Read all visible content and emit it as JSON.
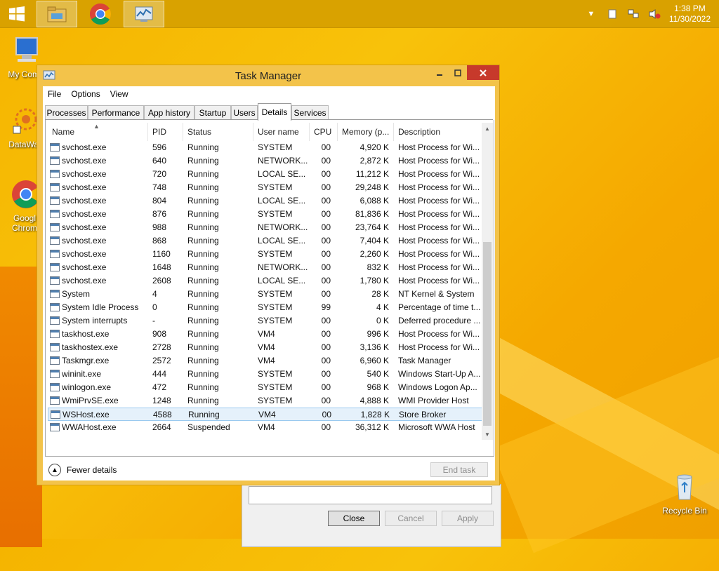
{
  "taskbar": {
    "clock_time": "1:38 PM",
    "clock_date": "11/30/2022",
    "apps": [
      "file-explorer-icon",
      "chrome-icon",
      "task-manager-icon"
    ]
  },
  "desktop": {
    "icons": [
      {
        "label": "My Comp"
      },
      {
        "label": "DataWag"
      },
      {
        "label": "Googl Chrom"
      },
      {
        "label": "Recycle Bin"
      }
    ]
  },
  "bg_dialog": {
    "close_label": "Close",
    "cancel_label": "Cancel",
    "apply_label": "Apply"
  },
  "window": {
    "title": "Task Manager",
    "menu": [
      "File",
      "Options",
      "View"
    ],
    "tabs": [
      "Processes",
      "Performance",
      "App history",
      "Startup",
      "Users",
      "Details",
      "Services"
    ],
    "active_tab": "Details",
    "columns": [
      "Name",
      "PID",
      "Status",
      "User name",
      "CPU",
      "Memory (p...",
      "Description"
    ],
    "rows": [
      {
        "name": "svchost.exe",
        "pid": "596",
        "status": "Running",
        "user": "SYSTEM",
        "cpu": "00",
        "mem": "4,920 K",
        "desc": "Host Process for Wi..."
      },
      {
        "name": "svchost.exe",
        "pid": "640",
        "status": "Running",
        "user": "NETWORK...",
        "cpu": "00",
        "mem": "2,872 K",
        "desc": "Host Process for Wi..."
      },
      {
        "name": "svchost.exe",
        "pid": "720",
        "status": "Running",
        "user": "LOCAL SE...",
        "cpu": "00",
        "mem": "11,212 K",
        "desc": "Host Process for Wi..."
      },
      {
        "name": "svchost.exe",
        "pid": "748",
        "status": "Running",
        "user": "SYSTEM",
        "cpu": "00",
        "mem": "29,248 K",
        "desc": "Host Process for Wi..."
      },
      {
        "name": "svchost.exe",
        "pid": "804",
        "status": "Running",
        "user": "LOCAL SE...",
        "cpu": "00",
        "mem": "6,088 K",
        "desc": "Host Process for Wi..."
      },
      {
        "name": "svchost.exe",
        "pid": "876",
        "status": "Running",
        "user": "SYSTEM",
        "cpu": "00",
        "mem": "81,836 K",
        "desc": "Host Process for Wi..."
      },
      {
        "name": "svchost.exe",
        "pid": "988",
        "status": "Running",
        "user": "NETWORK...",
        "cpu": "00",
        "mem": "23,764 K",
        "desc": "Host Process for Wi..."
      },
      {
        "name": "svchost.exe",
        "pid": "868",
        "status": "Running",
        "user": "LOCAL SE...",
        "cpu": "00",
        "mem": "7,404 K",
        "desc": "Host Process for Wi..."
      },
      {
        "name": "svchost.exe",
        "pid": "1160",
        "status": "Running",
        "user": "SYSTEM",
        "cpu": "00",
        "mem": "2,260 K",
        "desc": "Host Process for Wi..."
      },
      {
        "name": "svchost.exe",
        "pid": "1648",
        "status": "Running",
        "user": "NETWORK...",
        "cpu": "00",
        "mem": "832 K",
        "desc": "Host Process for Wi..."
      },
      {
        "name": "svchost.exe",
        "pid": "2608",
        "status": "Running",
        "user": "LOCAL SE...",
        "cpu": "00",
        "mem": "1,780 K",
        "desc": "Host Process for Wi..."
      },
      {
        "name": "System",
        "pid": "4",
        "status": "Running",
        "user": "SYSTEM",
        "cpu": "00",
        "mem": "28 K",
        "desc": "NT Kernel & System"
      },
      {
        "name": "System Idle Process",
        "pid": "0",
        "status": "Running",
        "user": "SYSTEM",
        "cpu": "99",
        "mem": "4 K",
        "desc": "Percentage of time t..."
      },
      {
        "name": "System interrupts",
        "pid": "-",
        "status": "Running",
        "user": "SYSTEM",
        "cpu": "00",
        "mem": "0 K",
        "desc": "Deferred procedure ..."
      },
      {
        "name": "taskhost.exe",
        "pid": "908",
        "status": "Running",
        "user": "VM4",
        "cpu": "00",
        "mem": "996 K",
        "desc": "Host Process for Wi..."
      },
      {
        "name": "taskhostex.exe",
        "pid": "2728",
        "status": "Running",
        "user": "VM4",
        "cpu": "00",
        "mem": "3,136 K",
        "desc": "Host Process for Wi..."
      },
      {
        "name": "Taskmgr.exe",
        "pid": "2572",
        "status": "Running",
        "user": "VM4",
        "cpu": "00",
        "mem": "6,960 K",
        "desc": "Task Manager"
      },
      {
        "name": "wininit.exe",
        "pid": "444",
        "status": "Running",
        "user": "SYSTEM",
        "cpu": "00",
        "mem": "540 K",
        "desc": "Windows Start-Up A..."
      },
      {
        "name": "winlogon.exe",
        "pid": "472",
        "status": "Running",
        "user": "SYSTEM",
        "cpu": "00",
        "mem": "968 K",
        "desc": "Windows Logon Ap..."
      },
      {
        "name": "WmiPrvSE.exe",
        "pid": "1248",
        "status": "Running",
        "user": "SYSTEM",
        "cpu": "00",
        "mem": "4,888 K",
        "desc": "WMI Provider Host"
      },
      {
        "name": "WSHost.exe",
        "pid": "4588",
        "status": "Running",
        "user": "VM4",
        "cpu": "00",
        "mem": "1,828 K",
        "desc": "Store Broker",
        "selected": true
      },
      {
        "name": "WWAHost.exe",
        "pid": "2664",
        "status": "Suspended",
        "user": "VM4",
        "cpu": "00",
        "mem": "36,312 K",
        "desc": "Microsoft WWA Host"
      }
    ],
    "fewer_details": "Fewer details",
    "end_task": "End task"
  }
}
